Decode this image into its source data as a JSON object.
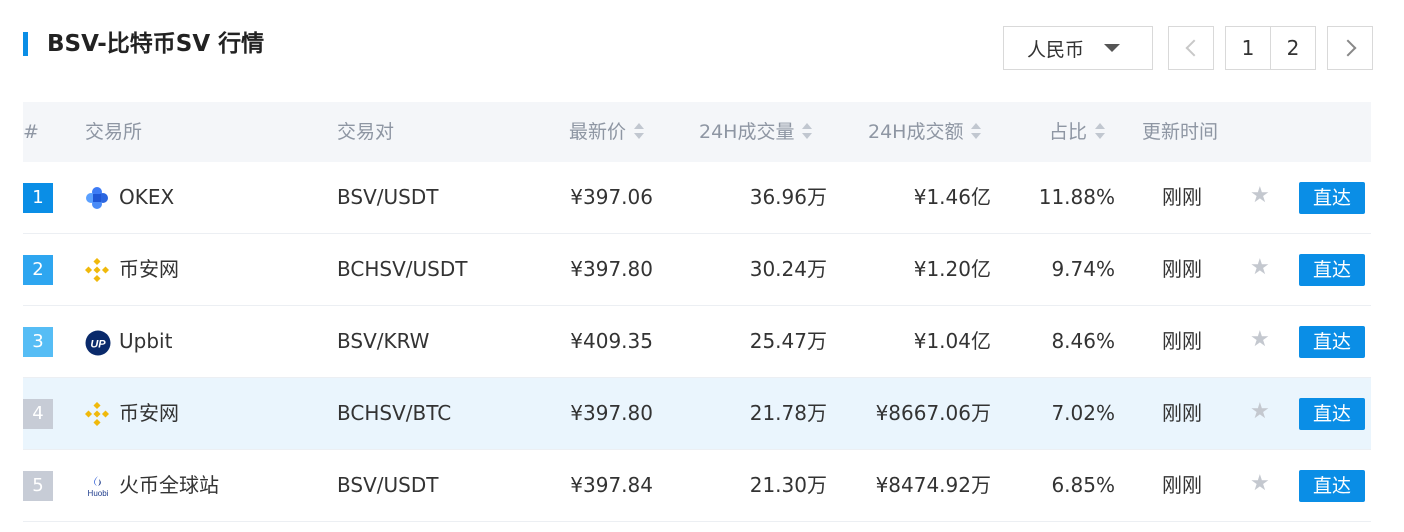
{
  "header": {
    "title": "BSV-比特币SV 行情"
  },
  "currency": {
    "selected": "人民币"
  },
  "pagination": {
    "pages": [
      "1",
      "2"
    ]
  },
  "table": {
    "columns": {
      "rank": "#",
      "exchange": "交易所",
      "pair": "交易对",
      "price": "最新价",
      "volume": "24H成交量",
      "amount": "24H成交额",
      "share": "占比",
      "updated": "更新时间"
    },
    "rows": [
      {
        "rank": "1",
        "rank_color": "#0a8ee6",
        "icon": "okex-logo",
        "exchange": "OKEX",
        "pair": "BSV/USDT",
        "price": "¥397.06",
        "volume": "36.96万",
        "amount": "¥1.46亿",
        "share": "11.88%",
        "updated": "刚刚",
        "action": "直达"
      },
      {
        "rank": "2",
        "rank_color": "#2ea6f0",
        "icon": "binance-logo",
        "exchange": "币安网",
        "pair": "BCHSV/USDT",
        "price": "¥397.80",
        "volume": "30.24万",
        "amount": "¥1.20亿",
        "share": "9.74%",
        "updated": "刚刚",
        "action": "直达"
      },
      {
        "rank": "3",
        "rank_color": "#56bdf5",
        "icon": "upbit-logo",
        "exchange": "Upbit",
        "pair": "BSV/KRW",
        "price": "¥409.35",
        "volume": "25.47万",
        "amount": "¥1.04亿",
        "share": "8.46%",
        "updated": "刚刚",
        "action": "直达"
      },
      {
        "rank": "4",
        "rank_color": "#c7ccd6",
        "icon": "binance-logo",
        "exchange": "币安网",
        "pair": "BCHSV/BTC",
        "price": "¥397.80",
        "volume": "21.78万",
        "amount": "¥8667.06万",
        "share": "7.02%",
        "updated": "刚刚",
        "action": "直达"
      },
      {
        "rank": "5",
        "rank_color": "#c7ccd6",
        "icon": "huobi-logo",
        "icon_text": "Huobi",
        "exchange": "火币全球站",
        "pair": "BSV/USDT",
        "price": "¥397.84",
        "volume": "21.30万",
        "amount": "¥8474.92万",
        "share": "6.85%",
        "updated": "刚刚",
        "action": "直达"
      }
    ]
  },
  "colors": {
    "accent": "#0a8ee6",
    "highlight_row": "#eaf5fd",
    "binance": "#f0b90b",
    "upbit": "#0a2a6b"
  }
}
